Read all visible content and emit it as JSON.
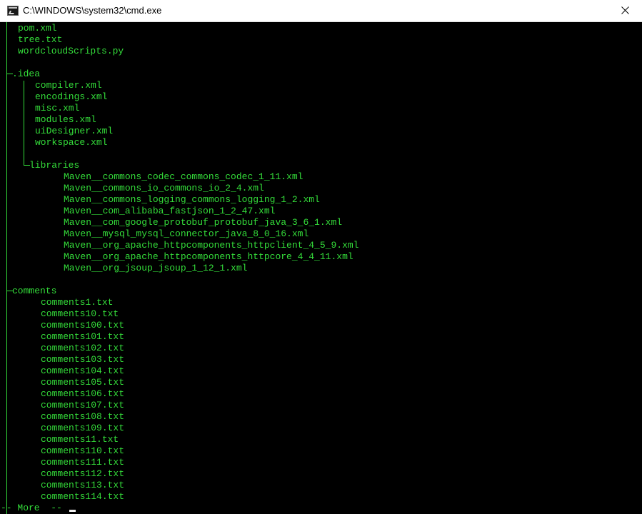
{
  "window": {
    "title": "C:\\WINDOWS\\system32\\cmd.exe",
    "icon": "cmd-icon",
    "close_icon": "close-icon"
  },
  "console": {
    "text_color": "#34dd3a",
    "root_files": [
      "pom.xml",
      "tree.txt",
      "wordcloudScripts.py"
    ],
    "idea": {
      "label": ".idea",
      "files": [
        "compiler.xml",
        "encodings.xml",
        "misc.xml",
        "modules.xml",
        "uiDesigner.xml",
        "workspace.xml"
      ],
      "libraries": {
        "label": "libraries",
        "files": [
          "Maven__commons_codec_commons_codec_1_11.xml",
          "Maven__commons_io_commons_io_2_4.xml",
          "Maven__commons_logging_commons_logging_1_2.xml",
          "Maven__com_alibaba_fastjson_1_2_47.xml",
          "Maven__com_google_protobuf_protobuf_java_3_6_1.xml",
          "Maven__mysql_mysql_connector_java_8_0_16.xml",
          "Maven__org_apache_httpcomponents_httpclient_4_5_9.xml",
          "Maven__org_apache_httpcomponents_httpcore_4_4_11.xml",
          "Maven__org_jsoup_jsoup_1_12_1.xml"
        ]
      }
    },
    "comments": {
      "label": "comments",
      "files": [
        "comments1.txt",
        "comments10.txt",
        "comments100.txt",
        "comments101.txt",
        "comments102.txt",
        "comments103.txt",
        "comments104.txt",
        "comments105.txt",
        "comments106.txt",
        "comments107.txt",
        "comments108.txt",
        "comments109.txt",
        "comments11.txt",
        "comments110.txt",
        "comments111.txt",
        "comments112.txt",
        "comments113.txt",
        "comments114.txt"
      ]
    },
    "more_prompt": "-- More  --"
  }
}
